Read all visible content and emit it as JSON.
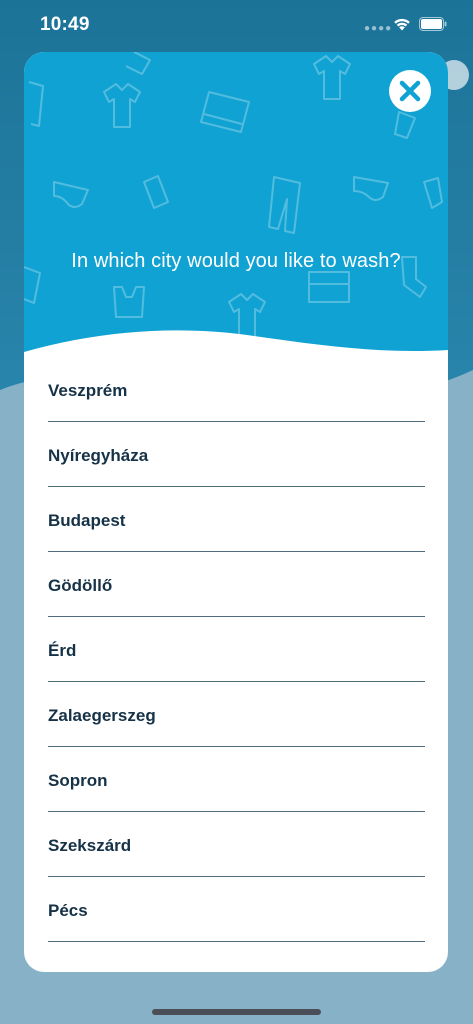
{
  "status_bar": {
    "time": "10:49",
    "signal_icon": "signal-dots-icon",
    "wifi_icon": "wifi-icon",
    "battery_icon": "battery-icon"
  },
  "modal": {
    "title": "In which city would you like to wash?",
    "close_icon": "close-icon",
    "header_color": "#10a2d3",
    "pattern_icons": [
      "shirt-icon",
      "trousers-icon",
      "sock-icon",
      "underwear-icon",
      "towel-icon",
      "tank-top-icon"
    ]
  },
  "cities": [
    "Veszprém",
    "Nyíregyháza",
    "Budapest",
    "Gödöllő",
    "Érd",
    "Zalaegerszeg",
    "Sopron",
    "Szekszárd",
    "Pécs"
  ],
  "colors": {
    "accent": "#10a2d3",
    "text_dark": "#163247",
    "divider": "#4d6b7d"
  }
}
